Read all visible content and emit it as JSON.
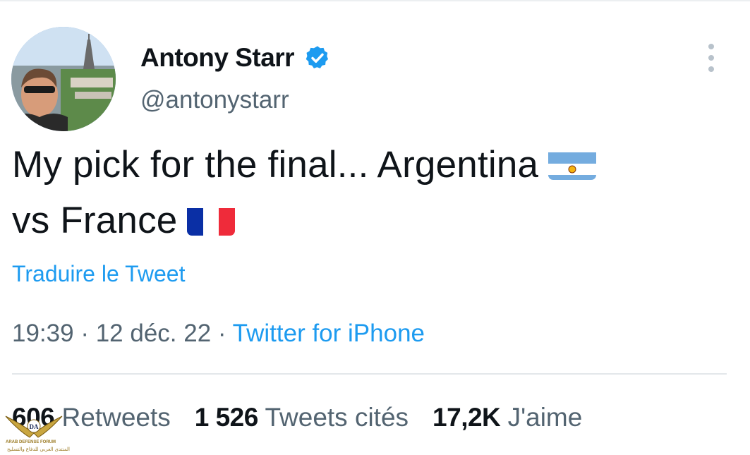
{
  "author": {
    "display_name": "Antony Starr",
    "handle": "@antonystarr",
    "verified": true
  },
  "tweet": {
    "line1": "My pick for the final... Argentina",
    "line2": "vs France",
    "flags": [
      "argentina-flag",
      "france-flag"
    ]
  },
  "translate_label": "Traduire le Tweet",
  "meta": {
    "time": "19:39",
    "separator": " · ",
    "date": "12 déc. 22",
    "source": "Twitter for iPhone"
  },
  "stats": {
    "retweets_count": "606",
    "retweets_label": "Retweets",
    "quotes_count": "1 526",
    "quotes_label": "Tweets cités",
    "likes_count": "17,2K",
    "likes_label": "J'aime"
  },
  "watermark": {
    "logo_text": "DA",
    "line1": "ARAB DEFENSE FORUM",
    "line2": "المنتدى العربي للدفاع والتسليح"
  },
  "colors": {
    "link_blue": "#1d9bf0",
    "secondary_text": "#536471",
    "primary_text": "#0f1419"
  }
}
